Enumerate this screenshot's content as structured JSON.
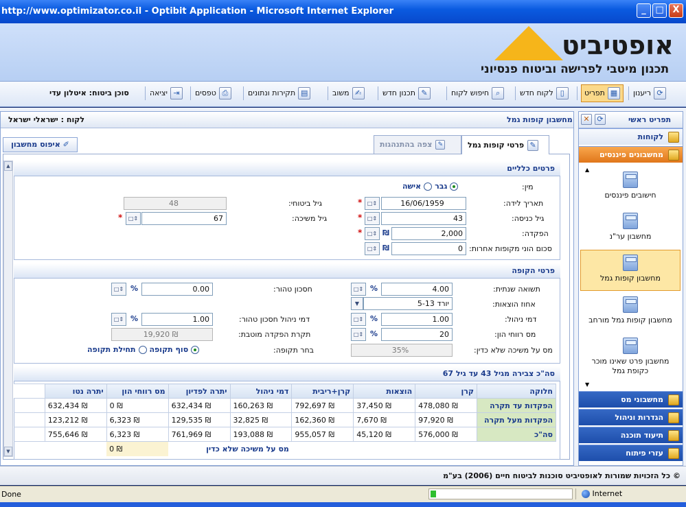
{
  "window": {
    "title": "http://www.optimizator.co.il - Optibit Application - Microsoft Internet Explorer",
    "min": "_",
    "max": "□",
    "close": "X"
  },
  "banner": {
    "logo_word": "אופטיביט",
    "tagline": "תכנון מיטבי לפרישה וביטוח פנסיוני"
  },
  "toolbar": {
    "refresh": "ריענון",
    "menu": "תפריט",
    "new_client": "לקוח חדש",
    "search_client": "חיפוש לקוח",
    "new_plan": "תכנון חדש",
    "feedback": "משוב",
    "regulations": "תקירות ונתונים",
    "forms": "טפסים",
    "exit": "יציאה",
    "agent_label": "סוכן ביטוח:",
    "agent_name": "איטלון עדי"
  },
  "header": {
    "title": "מחשבון קופות גמל",
    "client_label": "לקוח :",
    "client_name": "ישראלי ישראל"
  },
  "tabs": {
    "details": "פרטי קופות גמל",
    "behavior": "צפה בהתנהגות",
    "reset": "איפוס מחשבון"
  },
  "general": {
    "title": "פרטים כלליים",
    "gender_label": "מין:",
    "gender_male": "גבר",
    "gender_female": "אישה",
    "birth_label": "תאריך לידה:",
    "birth_value": "16/06/1959",
    "entry_age_label": "גיל כניסה:",
    "entry_age_value": "43",
    "deposit_label": "הפקדה:",
    "deposit_value": "2,000",
    "other_funds_label": "סכום הוני מקופות אחרות:",
    "other_funds_value": "0",
    "insurance_age_label": "גיל ביטוחי:",
    "insurance_age_value": "48",
    "withdraw_age_label": "גיל משיכה:",
    "withdraw_age_value": "67",
    "currency": "₪",
    "required": "*"
  },
  "fund": {
    "title": "פרטי הקופה",
    "annual_return_label": "תשואה שנתית:",
    "annual_return_value": "4.00",
    "expenses_label": "אחוז הוצאות:",
    "expenses_value": "יורד 5-13",
    "mgmt_fee_label": "דמי ניהול:",
    "mgmt_fee_value": "1.00",
    "cap_gains_label": "מס רווחי הון:",
    "cap_gains_value": "20",
    "tax_withdraw_label": "מס על משיכה שלא כדין:",
    "tax_withdraw_value": "35%",
    "pure_saving_label": "חסכון טהור:",
    "pure_saving_value": "0.00",
    "pure_saving_fee_label": "דמי ניהול חסכון טהור:",
    "pure_saving_fee_value": "1.00",
    "ceiling_label": "תקרת הפקדה מוטבת:",
    "ceiling_value": "19,920 ₪",
    "period_label": "בחר תקופה:",
    "period_end": "סוף תקופה",
    "period_start": "תחילת תקופה",
    "percent": "%"
  },
  "summary": {
    "title": "סה\"כ צבירה מגיל 43 עד גיל 67",
    "columns": [
      "חלוקה",
      "קרן",
      "הוצאות",
      "קרן+ריבית",
      "דמי ניהול",
      "יתרה לפדיון",
      "מס רווחי הון",
      "יתרה נטו"
    ],
    "rows": [
      [
        "הפקדות עד תקרה",
        "478,080 ₪",
        "37,450 ₪",
        "792,697 ₪",
        "160,263 ₪",
        "632,434 ₪",
        "0 ₪",
        "632,434 ₪"
      ],
      [
        "הפקדות מעל תקרה",
        "97,920 ₪",
        "7,670 ₪",
        "162,360 ₪",
        "32,825 ₪",
        "129,535 ₪",
        "6,323 ₪",
        "123,212 ₪"
      ],
      [
        "סה\"כ",
        "576,000 ₪",
        "45,120 ₪",
        "955,057 ₪",
        "193,088 ₪",
        "761,969 ₪",
        "6,323 ₪",
        "755,646 ₪"
      ]
    ],
    "tax_label": "מס על משיכה שלא כדין",
    "tax_value": "0 ₪"
  },
  "sidebar": {
    "title": "תפריט ראשי",
    "clients": "לקוחות",
    "calculators": "מחשבונים פיננסים",
    "items": [
      "חישובים פיננסים",
      "מחשבון ער\"נ",
      "מחשבון קופות גמל",
      "מחשבון קופות גמל מורחב",
      "מחשבון פרט שאינו מוכר כקופת גמל"
    ],
    "tax_calc": "מחשבוני מס",
    "settings": "הגדרות וניהול",
    "docs": "תיעוד תוכנה",
    "dev": "עזרי פיתוח"
  },
  "footer": {
    "copyright": "© כל הזכויות שמורות לאופטיביט סוכנות לביטוח חיים (2006) בע\"מ"
  },
  "status": {
    "left": "Done",
    "zone": "Internet"
  }
}
